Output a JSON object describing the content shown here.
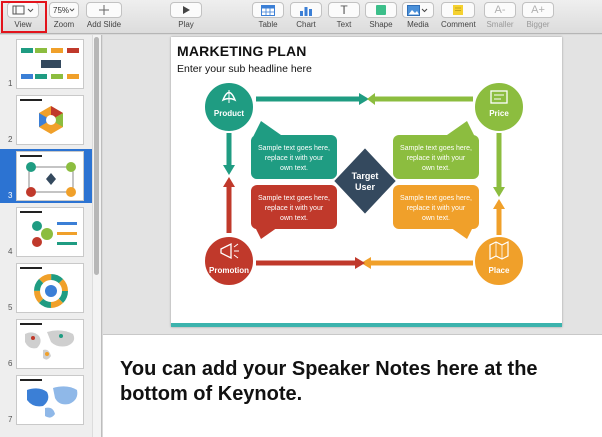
{
  "toolbar": {
    "view_label": "View",
    "zoom_value": "75%",
    "zoom_label": "Zoom",
    "add_slide_label": "Add Slide",
    "play_label": "Play",
    "table_label": "Table",
    "chart_label": "Chart",
    "text_label": "Text",
    "text_glyph": "T",
    "shape_label": "Shape",
    "media_label": "Media",
    "comment_label": "Comment",
    "smaller_label": "Smaller",
    "smaller_glyph": "A-",
    "bigger_label": "Bigger",
    "bigger_glyph": "A+"
  },
  "navigator": {
    "slides": [
      "1",
      "2",
      "3",
      "4",
      "5",
      "6",
      "7"
    ],
    "selected": "3"
  },
  "slide": {
    "title": "MARKETING PLAN",
    "subtitle": "Enter your sub headline here",
    "center_label": "Target User",
    "center_line1": "Target",
    "center_line2": "User",
    "nodes": {
      "product": "Product",
      "price": "Price",
      "promotion": "Promotion",
      "place": "Place"
    },
    "bubble_line1": "Sample text goes here,",
    "bubble_line2": "replace it with your",
    "bubble_line3": "own text.",
    "colors": {
      "product": "#1f9c82",
      "price": "#8cbd3f",
      "promotion": "#c0392b",
      "place": "#f0a02a",
      "center": "#34495e",
      "footer": "#3cb3ad"
    }
  },
  "notes": {
    "text": "You can add your Speaker Notes here at the bottom of Keynote."
  }
}
